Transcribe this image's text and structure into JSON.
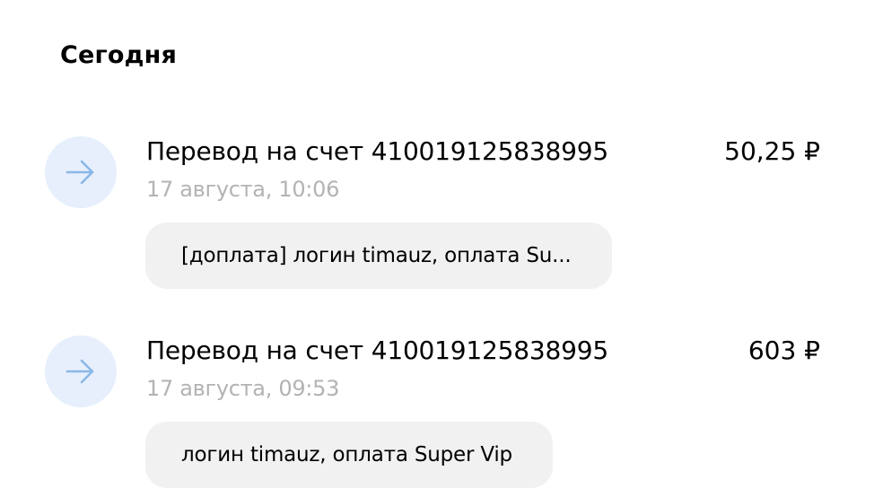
{
  "section": {
    "title": "Сегодня"
  },
  "operations": [
    {
      "icon": "arrow-right-icon",
      "title": "Перевод на счет 410019125838995",
      "amount": "50,25 ₽",
      "date": "17 августа, 10:06",
      "comment": "[доплата] логин timauz, оплата Su..."
    },
    {
      "icon": "arrow-right-icon",
      "title": "Перевод на счет 410019125838995",
      "amount": "603 ₽",
      "date": "17 августа, 09:53",
      "comment": "логин timauz, оплата Super Vip"
    }
  ],
  "colors": {
    "icon_bg": "#e6effb",
    "icon_arrow": "#8bb7e8",
    "date_text": "#b3b3b3",
    "comment_bg": "#f1f1f1"
  }
}
